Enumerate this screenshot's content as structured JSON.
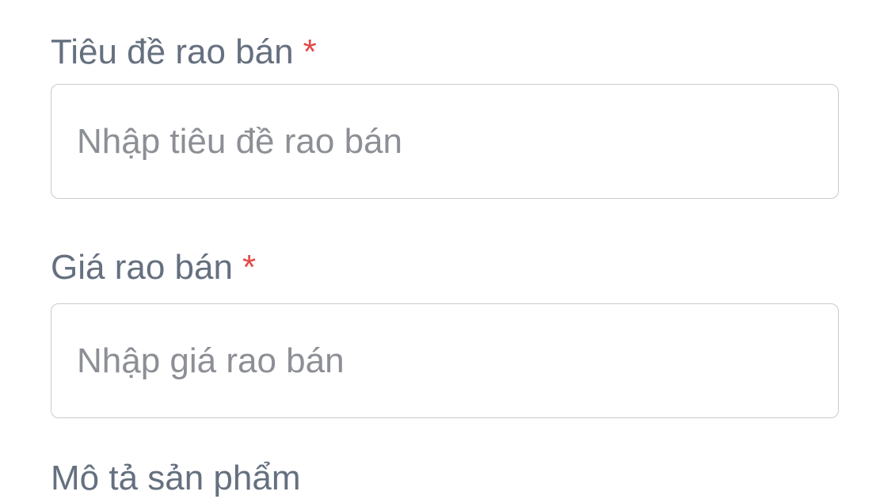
{
  "form": {
    "title_field": {
      "label": "Tiêu đề rao bán",
      "required_mark": "*",
      "placeholder": "Nhập tiêu đề rao bán",
      "value": ""
    },
    "price_field": {
      "label": "Giá rao bán",
      "required_mark": "*",
      "placeholder": "Nhập giá rao bán",
      "value": ""
    },
    "next_field": {
      "label": "Mô tả sản phẩm"
    }
  },
  "colors": {
    "label": "#65707f",
    "required": "#e34a4a",
    "placeholder": "#8d8f96",
    "border": "#c9cbcf"
  }
}
